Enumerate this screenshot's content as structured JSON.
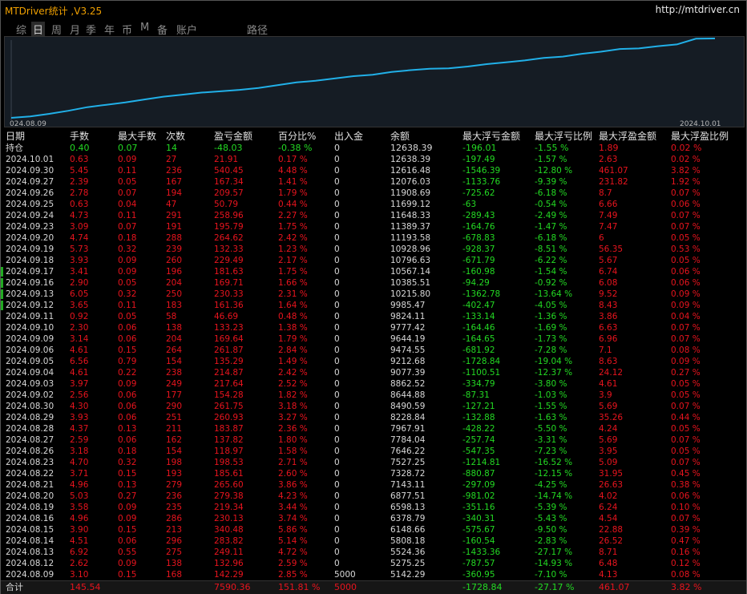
{
  "window": {
    "title": "MTDriver统计 ,V3.25",
    "url": "http://mtdriver.cn"
  },
  "tabs": [
    "综",
    "日",
    "周",
    "月",
    "季",
    "年",
    "币",
    "M",
    "备",
    "账户",
    "路径"
  ],
  "active_tab": "日",
  "chart": {
    "start_label": "024.08.09",
    "end_label": "2024.10.01",
    "line_color": "#21b0e8",
    "balance_series": [
      5142.29,
      5275.25,
      5524.36,
      5808.18,
      6148.66,
      6378.79,
      6598.13,
      6877.51,
      7143.11,
      7328.72,
      7527.25,
      7646.22,
      7784.04,
      7967.91,
      8228.84,
      8490.59,
      8644.88,
      8862.52,
      9077.39,
      9212.68,
      9474.55,
      9644.19,
      9777.42,
      9824.11,
      9985.47,
      10215.8,
      10385.51,
      10567.14,
      10796.63,
      10928.96,
      11193.58,
      11389.37,
      11648.33,
      11699.12,
      11908.69,
      12076.03,
      12616.48,
      12638.39
    ]
  },
  "columns": [
    "日期",
    "手数",
    "最大手数",
    "次数",
    "盈亏金额",
    "百分比%",
    "出入金",
    "余额",
    "最大浮亏金额",
    "最大浮亏比例",
    "最大浮盈金额",
    "最大浮盈比例"
  ],
  "holding": {
    "label": "持仓",
    "lots": "0.40",
    "max_lots": "0.07",
    "count": "14",
    "pnl": "-48.03",
    "pct": "-0.38 %",
    "inout": "0",
    "balance": "12638.39",
    "max_float_loss": "-196.01",
    "max_float_loss_pct": "-1.55 %",
    "max_float_profit": "1.89",
    "max_float_profit_pct": "0.02 %"
  },
  "rows": [
    {
      "date": "2024.10.01",
      "lots": "0.63",
      "max_lots": "0.09",
      "count": "27",
      "pnl": "21.91",
      "pct": "0.17 %",
      "inout": "0",
      "balance": "12638.39",
      "mfl": "-197.49",
      "mflp": "-1.57 %",
      "mfp": "2.63",
      "mfpp": "0.02 %",
      "mark": false
    },
    {
      "date": "2024.09.30",
      "lots": "5.45",
      "max_lots": "0.11",
      "count": "236",
      "pnl": "540.45",
      "pct": "4.48 %",
      "inout": "0",
      "balance": "12616.48",
      "mfl": "-1546.39",
      "mflp": "-12.80 %",
      "mfp": "461.07",
      "mfpp": "3.82 %",
      "mark": false
    },
    {
      "date": "2024.09.27",
      "lots": "2.39",
      "max_lots": "0.05",
      "count": "167",
      "pnl": "167.34",
      "pct": "1.41 %",
      "inout": "0",
      "balance": "12076.03",
      "mfl": "-1133.76",
      "mflp": "-9.39 %",
      "mfp": "231.82",
      "mfpp": "1.92 %",
      "mark": false
    },
    {
      "date": "2024.09.26",
      "lots": "2.78",
      "max_lots": "0.07",
      "count": "194",
      "pnl": "209.57",
      "pct": "1.79 %",
      "inout": "0",
      "balance": "11908.69",
      "mfl": "-725.62",
      "mflp": "-6.18 %",
      "mfp": "8.7",
      "mfpp": "0.07 %",
      "mark": false
    },
    {
      "date": "2024.09.25",
      "lots": "0.63",
      "max_lots": "0.04",
      "count": "47",
      "pnl": "50.79",
      "pct": "0.44 %",
      "inout": "0",
      "balance": "11699.12",
      "mfl": "-63",
      "mflp": "-0.54 %",
      "mfp": "6.66",
      "mfpp": "0.06 %",
      "mark": false
    },
    {
      "date": "2024.09.24",
      "lots": "4.73",
      "max_lots": "0.11",
      "count": "291",
      "pnl": "258.96",
      "pct": "2.27 %",
      "inout": "0",
      "balance": "11648.33",
      "mfl": "-289.43",
      "mflp": "-2.49 %",
      "mfp": "7.49",
      "mfpp": "0.07 %",
      "mark": false
    },
    {
      "date": "2024.09.23",
      "lots": "3.09",
      "max_lots": "0.07",
      "count": "191",
      "pnl": "195.79",
      "pct": "1.75 %",
      "inout": "0",
      "balance": "11389.37",
      "mfl": "-164.76",
      "mflp": "-1.47 %",
      "mfp": "7.47",
      "mfpp": "0.07 %",
      "mark": false
    },
    {
      "date": "2024.09.20",
      "lots": "4.74",
      "max_lots": "0.18",
      "count": "288",
      "pnl": "264.62",
      "pct": "2.42 %",
      "inout": "0",
      "balance": "11193.58",
      "mfl": "-678.83",
      "mflp": "-6.18 %",
      "mfp": "6",
      "mfpp": "0.05 %",
      "mark": false
    },
    {
      "date": "2024.09.19",
      "lots": "5.73",
      "max_lots": "0.32",
      "count": "239",
      "pnl": "132.33",
      "pct": "1.23 %",
      "inout": "0",
      "balance": "10928.96",
      "mfl": "-928.37",
      "mflp": "-8.51 %",
      "mfp": "56.35",
      "mfpp": "0.53 %",
      "mark": false
    },
    {
      "date": "2024.09.18",
      "lots": "3.93",
      "max_lots": "0.09",
      "count": "260",
      "pnl": "229.49",
      "pct": "2.17 %",
      "inout": "0",
      "balance": "10796.63",
      "mfl": "-671.79",
      "mflp": "-6.22 %",
      "mfp": "5.67",
      "mfpp": "0.05 %",
      "mark": false
    },
    {
      "date": "2024.09.17",
      "lots": "3.41",
      "max_lots": "0.09",
      "count": "196",
      "pnl": "181.63",
      "pct": "1.75 %",
      "inout": "0",
      "balance": "10567.14",
      "mfl": "-160.98",
      "mflp": "-1.54 %",
      "mfp": "6.74",
      "mfpp": "0.06 %",
      "mark": true
    },
    {
      "date": "2024.09.16",
      "lots": "2.90",
      "max_lots": "0.05",
      "count": "204",
      "pnl": "169.71",
      "pct": "1.66 %",
      "inout": "0",
      "balance": "10385.51",
      "mfl": "-94.29",
      "mflp": "-0.92 %",
      "mfp": "6.08",
      "mfpp": "0.06 %",
      "mark": true
    },
    {
      "date": "2024.09.13",
      "lots": "6.05",
      "max_lots": "0.32",
      "count": "250",
      "pnl": "230.33",
      "pct": "2.31 %",
      "inout": "0",
      "balance": "10215.80",
      "mfl": "-1362.78",
      "mflp": "-13.64 %",
      "mfp": "9.52",
      "mfpp": "0.09 %",
      "mark": true
    },
    {
      "date": "2024.09.12",
      "lots": "3.65",
      "max_lots": "0.11",
      "count": "183",
      "pnl": "161.36",
      "pct": "1.64 %",
      "inout": "0",
      "balance": "9985.47",
      "mfl": "-402.47",
      "mflp": "-4.05 %",
      "mfp": "8.43",
      "mfpp": "0.09 %",
      "mark": true
    },
    {
      "date": "2024.09.11",
      "lots": "0.92",
      "max_lots": "0.05",
      "count": "58",
      "pnl": "46.69",
      "pct": "0.48 %",
      "inout": "0",
      "balance": "9824.11",
      "mfl": "-133.14",
      "mflp": "-1.36 %",
      "mfp": "3.86",
      "mfpp": "0.04 %",
      "mark": false
    },
    {
      "date": "2024.09.10",
      "lots": "2.30",
      "max_lots": "0.06",
      "count": "138",
      "pnl": "133.23",
      "pct": "1.38 %",
      "inout": "0",
      "balance": "9777.42",
      "mfl": "-164.46",
      "mflp": "-1.69 %",
      "mfp": "6.63",
      "mfpp": "0.07 %",
      "mark": false
    },
    {
      "date": "2024.09.09",
      "lots": "3.14",
      "max_lots": "0.06",
      "count": "204",
      "pnl": "169.64",
      "pct": "1.79 %",
      "inout": "0",
      "balance": "9644.19",
      "mfl": "-164.65",
      "mflp": "-1.73 %",
      "mfp": "6.96",
      "mfpp": "0.07 %",
      "mark": false
    },
    {
      "date": "2024.09.06",
      "lots": "4.61",
      "max_lots": "0.15",
      "count": "264",
      "pnl": "261.87",
      "pct": "2.84 %",
      "inout": "0",
      "balance": "9474.55",
      "mfl": "-681.92",
      "mflp": "-7.28 %",
      "mfp": "7.1",
      "mfpp": "0.08 %",
      "mark": false
    },
    {
      "date": "2024.09.05",
      "lots": "6.56",
      "max_lots": "0.79",
      "count": "154",
      "pnl": "135.29",
      "pct": "1.49 %",
      "inout": "0",
      "balance": "9212.68",
      "mfl": "-1728.84",
      "mflp": "-19.04 %",
      "mfp": "8.63",
      "mfpp": "0.09 %",
      "mark": false
    },
    {
      "date": "2024.09.04",
      "lots": "4.61",
      "max_lots": "0.22",
      "count": "238",
      "pnl": "214.87",
      "pct": "2.42 %",
      "inout": "0",
      "balance": "9077.39",
      "mfl": "-1100.51",
      "mflp": "-12.37 %",
      "mfp": "24.12",
      "mfpp": "0.27 %",
      "mark": false
    },
    {
      "date": "2024.09.03",
      "lots": "3.97",
      "max_lots": "0.09",
      "count": "249",
      "pnl": "217.64",
      "pct": "2.52 %",
      "inout": "0",
      "balance": "8862.52",
      "mfl": "-334.79",
      "mflp": "-3.80 %",
      "mfp": "4.61",
      "mfpp": "0.05 %",
      "mark": false
    },
    {
      "date": "2024.09.02",
      "lots": "2.56",
      "max_lots": "0.06",
      "count": "177",
      "pnl": "154.28",
      "pct": "1.82 %",
      "inout": "0",
      "balance": "8644.88",
      "mfl": "-87.31",
      "mflp": "-1.03 %",
      "mfp": "3.9",
      "mfpp": "0.05 %",
      "mark": false
    },
    {
      "date": "2024.08.30",
      "lots": "4.30",
      "max_lots": "0.06",
      "count": "290",
      "pnl": "261.75",
      "pct": "3.18 %",
      "inout": "0",
      "balance": "8490.59",
      "mfl": "-127.21",
      "mflp": "-1.55 %",
      "mfp": "5.69",
      "mfpp": "0.07 %",
      "mark": false
    },
    {
      "date": "2024.08.29",
      "lots": "3.93",
      "max_lots": "0.06",
      "count": "251",
      "pnl": "260.93",
      "pct": "3.27 %",
      "inout": "0",
      "balance": "8228.84",
      "mfl": "-132.88",
      "mflp": "-1.63 %",
      "mfp": "35.26",
      "mfpp": "0.44 %",
      "mark": false
    },
    {
      "date": "2024.08.28",
      "lots": "4.37",
      "max_lots": "0.13",
      "count": "211",
      "pnl": "183.87",
      "pct": "2.36 %",
      "inout": "0",
      "balance": "7967.91",
      "mfl": "-428.22",
      "mflp": "-5.50 %",
      "mfp": "4.24",
      "mfpp": "0.05 %",
      "mark": false
    },
    {
      "date": "2024.08.27",
      "lots": "2.59",
      "max_lots": "0.06",
      "count": "162",
      "pnl": "137.82",
      "pct": "1.80 %",
      "inout": "0",
      "balance": "7784.04",
      "mfl": "-257.74",
      "mflp": "-3.31 %",
      "mfp": "5.69",
      "mfpp": "0.07 %",
      "mark": false
    },
    {
      "date": "2024.08.26",
      "lots": "3.18",
      "max_lots": "0.18",
      "count": "154",
      "pnl": "118.97",
      "pct": "1.58 %",
      "inout": "0",
      "balance": "7646.22",
      "mfl": "-547.35",
      "mflp": "-7.23 %",
      "mfp": "3.95",
      "mfpp": "0.05 %",
      "mark": false
    },
    {
      "date": "2024.08.23",
      "lots": "4.70",
      "max_lots": "0.32",
      "count": "198",
      "pnl": "198.53",
      "pct": "2.71 %",
      "inout": "0",
      "balance": "7527.25",
      "mfl": "-1214.81",
      "mflp": "-16.52 %",
      "mfp": "5.09",
      "mfpp": "0.07 %",
      "mark": false
    },
    {
      "date": "2024.08.22",
      "lots": "3.71",
      "max_lots": "0.15",
      "count": "193",
      "pnl": "185.61",
      "pct": "2.60 %",
      "inout": "0",
      "balance": "7328.72",
      "mfl": "-880.87",
      "mflp": "-12.15 %",
      "mfp": "31.95",
      "mfpp": "0.45 %",
      "mark": false
    },
    {
      "date": "2024.08.21",
      "lots": "4.96",
      "max_lots": "0.13",
      "count": "279",
      "pnl": "265.60",
      "pct": "3.86 %",
      "inout": "0",
      "balance": "7143.11",
      "mfl": "-297.09",
      "mflp": "-4.25 %",
      "mfp": "26.63",
      "mfpp": "0.38 %",
      "mark": false
    },
    {
      "date": "2024.08.20",
      "lots": "5.03",
      "max_lots": "0.27",
      "count": "236",
      "pnl": "279.38",
      "pct": "4.23 %",
      "inout": "0",
      "balance": "6877.51",
      "mfl": "-981.02",
      "mflp": "-14.74 %",
      "mfp": "4.02",
      "mfpp": "0.06 %",
      "mark": false
    },
    {
      "date": "2024.08.19",
      "lots": "3.58",
      "max_lots": "0.09",
      "count": "235",
      "pnl": "219.34",
      "pct": "3.44 %",
      "inout": "0",
      "balance": "6598.13",
      "mfl": "-351.16",
      "mflp": "-5.39 %",
      "mfp": "6.24",
      "mfpp": "0.10 %",
      "mark": false
    },
    {
      "date": "2024.08.16",
      "lots": "4.96",
      "max_lots": "0.09",
      "count": "286",
      "pnl": "230.13",
      "pct": "3.74 %",
      "inout": "0",
      "balance": "6378.79",
      "mfl": "-340.31",
      "mflp": "-5.43 %",
      "mfp": "4.54",
      "mfpp": "0.07 %",
      "mark": false
    },
    {
      "date": "2024.08.15",
      "lots": "3.90",
      "max_lots": "0.15",
      "count": "213",
      "pnl": "340.48",
      "pct": "5.86 %",
      "inout": "0",
      "balance": "6148.66",
      "mfl": "-575.67",
      "mflp": "-9.50 %",
      "mfp": "22.88",
      "mfpp": "0.39 %",
      "mark": false
    },
    {
      "date": "2024.08.14",
      "lots": "4.51",
      "max_lots": "0.06",
      "count": "296",
      "pnl": "283.82",
      "pct": "5.14 %",
      "inout": "0",
      "balance": "5808.18",
      "mfl": "-160.54",
      "mflp": "-2.83 %",
      "mfp": "26.52",
      "mfpp": "0.47 %",
      "mark": false
    },
    {
      "date": "2024.08.13",
      "lots": "6.92",
      "max_lots": "0.55",
      "count": "275",
      "pnl": "249.11",
      "pct": "4.72 %",
      "inout": "0",
      "balance": "5524.36",
      "mfl": "-1433.36",
      "mflp": "-27.17 %",
      "mfp": "8.71",
      "mfpp": "0.16 %",
      "mark": false
    },
    {
      "date": "2024.08.12",
      "lots": "2.62",
      "max_lots": "0.09",
      "count": "138",
      "pnl": "132.96",
      "pct": "2.59 %",
      "inout": "0",
      "balance": "5275.25",
      "mfl": "-787.57",
      "mflp": "-14.93 %",
      "mfp": "6.48",
      "mfpp": "0.12 %",
      "mark": false
    },
    {
      "date": "2024.08.09",
      "lots": "3.10",
      "max_lots": "0.15",
      "count": "168",
      "pnl": "142.29",
      "pct": "2.85 %",
      "inout": "5000",
      "balance": "5142.29",
      "mfl": "-360.95",
      "mflp": "-7.10 %",
      "mfp": "4.13",
      "mfpp": "0.08 %",
      "mark": false
    }
  ],
  "total": {
    "label": "合计",
    "lots": "145.54",
    "pnl": "7590.36",
    "pct": "151.81 %",
    "inout": "5000",
    "mfl": "-1728.84",
    "mflp": "-27.17 %",
    "mfp": "461.07",
    "mfpp": "3.82 %"
  },
  "colors": {
    "positive": "#e8141e",
    "negative": "#23d923",
    "accent": "#f0a000",
    "curve": "#21b0e8"
  }
}
